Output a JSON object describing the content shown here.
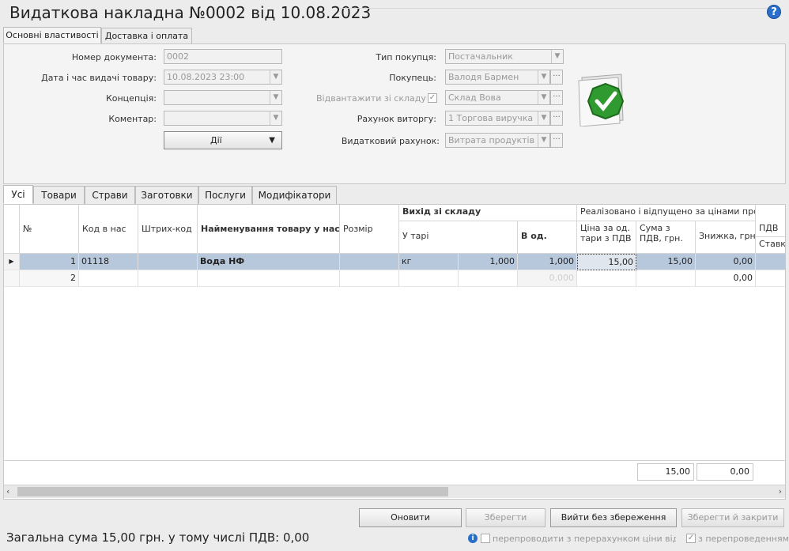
{
  "title": "Видаткова накладна №0002 від 10.08.2023",
  "help_glyph": "?",
  "top_tabs": [
    "Основні властивості",
    "Доставка і оплата"
  ],
  "form": {
    "doc_number_label": "Номер документа:",
    "doc_number": "0002",
    "date_label": "Дата і час видачі товару:",
    "date": "10.08.2023 23:00",
    "concept_label": "Концепція:",
    "concept": "",
    "comment_label": "Коментар:",
    "comment": "",
    "actions_label": "Дії",
    "buyer_type_label": "Тип покупця:",
    "buyer_type": "Постачальник",
    "buyer_label": "Покупець:",
    "buyer": "Валодя Бармен",
    "ship_from_label": "Відвантажити зі складу",
    "ship_from": "Склад Вова",
    "revenue_label": "Рахунок виторгу:",
    "revenue": "1 Торгова виручка",
    "expense_label": "Видатковий рахунок:",
    "expense": "Витрата продуктів"
  },
  "item_tabs": [
    "Усі",
    "Товари",
    "Страви",
    "Заготовки",
    "Послуги",
    "Модифікатори"
  ],
  "table": {
    "headers": {
      "no": "№",
      "code": "Код в нас",
      "barcode": "Штрих-код",
      "name": "Найменування товару у нас",
      "size": "Розмір",
      "out_group": "Вихід зі складу",
      "in_pack": "У тарі",
      "in_units": "В од.",
      "realized_group": "Реалізовано і відпущено за цінами продажу",
      "price": "Ціна за од. тари з ПДВ",
      "sum": "Сума з ПДВ, грн.",
      "discount": "Знижка, грн.",
      "vat_group": "ПДВ",
      "vat_rate": "Ставка"
    },
    "rows": [
      {
        "no": "1",
        "code": "01118",
        "barcode": "",
        "name": "Вода НФ",
        "size": "",
        "pack_unit": "кг",
        "pack_qty": "1,000",
        "units": "1,000",
        "price": "15,00",
        "sum": "15,00",
        "discount": "0,00"
      },
      {
        "no": "2",
        "code": "",
        "barcode": "",
        "name": "",
        "size": "",
        "pack_unit": "",
        "pack_qty": "",
        "units": "0,000",
        "price": "",
        "sum": "",
        "discount": "0,00"
      }
    ],
    "totals": {
      "sum": "15,00",
      "discount": "0,00"
    }
  },
  "buttons": {
    "refresh": "Оновити",
    "save": "Зберегти",
    "exit": "Вийти без збереження",
    "save_close": "Зберегти й закрити"
  },
  "summary": "Загальна сума 15,00 грн. у тому числі ПДВ: 0,00",
  "options": {
    "repost_label": "перепроводити з перерахунком ціни відванта",
    "with_posting_label": "з перепроведенням"
  }
}
